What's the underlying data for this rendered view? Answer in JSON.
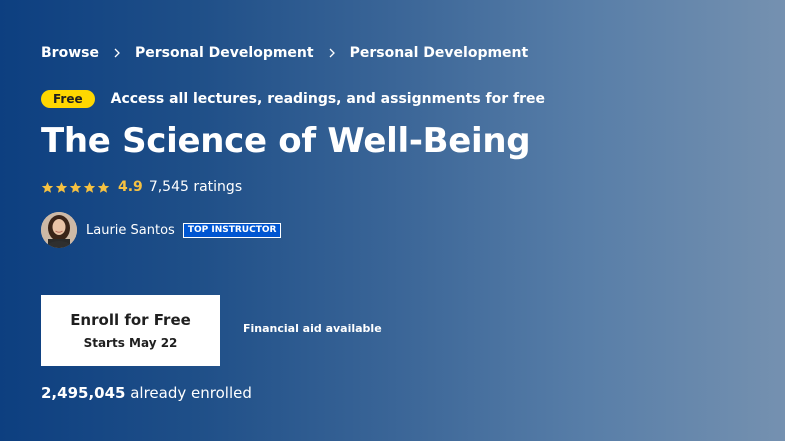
{
  "breadcrumb": {
    "items": [
      "Browse",
      "Personal Development",
      "Personal Development"
    ]
  },
  "free_banner": {
    "badge": "Free",
    "text": "Access all lectures, readings, and assignments for free"
  },
  "course": {
    "title": "The Science of Well-Being"
  },
  "rating": {
    "stars": 5,
    "value": "4.9",
    "count": "7,545 ratings"
  },
  "instructor": {
    "name": "Laurie Santos",
    "badge": "TOP INSTRUCTOR"
  },
  "enroll": {
    "label": "Enroll for Free",
    "starts": "Starts May 22"
  },
  "financial_aid": "Financial aid available",
  "enrolled": {
    "count": "2,495,045",
    "suffix": " already enrolled"
  },
  "colors": {
    "badge_yellow": "#ffd700",
    "star_gold": "#f5c142",
    "instructor_blue": "#0056d2",
    "gradient_start": "#0d3f80",
    "gradient_end": "#7591b0"
  },
  "icons": [
    "chevron-right-icon",
    "star-icon"
  ]
}
